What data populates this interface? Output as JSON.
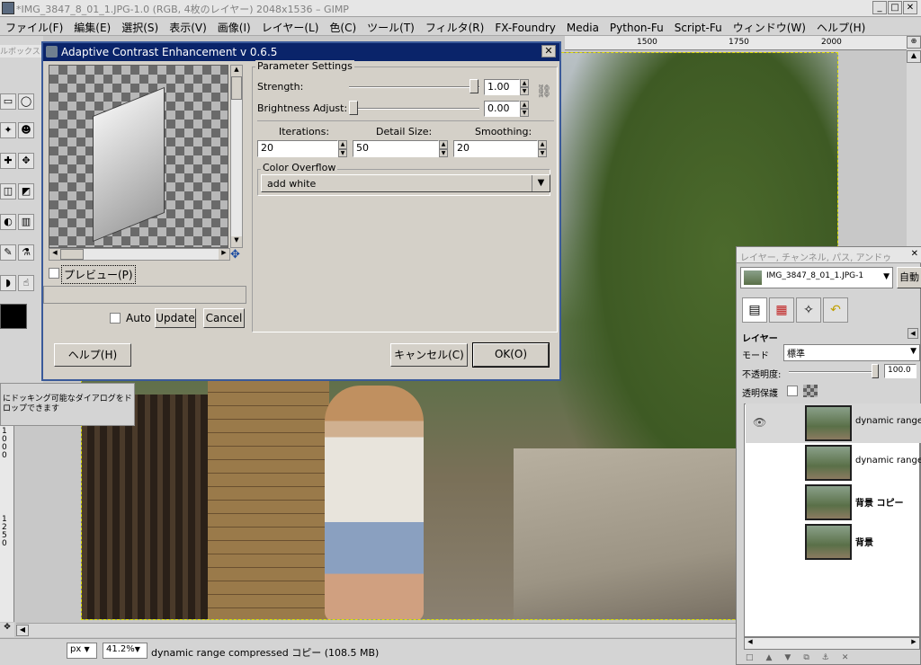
{
  "window": {
    "title": "*IMG_3847_8_01_1.JPG-1.0 (RGB, 4枚のレイヤー) 2048x1536 – GIMP",
    "min": "_",
    "max": "□",
    "close": "✕"
  },
  "menu": [
    "ファイル(F)",
    "編集(E)",
    "選択(S)",
    "表示(V)",
    "画像(I)",
    "レイヤー(L)",
    "色(C)",
    "ツール(T)",
    "フィルタ(R)",
    "FX-Foundry",
    "Media",
    "Python-Fu",
    "Script-Fu",
    "ウィンドウ(W)",
    "ヘルプ(H)"
  ],
  "ruler": {
    "h": [
      "1500",
      "1750",
      "2000"
    ],
    "v": [
      "1000",
      "1250"
    ]
  },
  "toolbox": {
    "label": "ルボックス",
    "dock_hint": "にドッキング可能なダイアログをドロップできます"
  },
  "dialog": {
    "title": "Adaptive Contrast Enhancement v 0.6.5",
    "close": "✕",
    "preview_label": "プレビュー(P)",
    "auto_label": "Auto",
    "update": "Update",
    "cancel": "Cancel",
    "params_title": "Parameter Settings",
    "strength_label": "Strength:",
    "strength_value": "1.00",
    "brightness_label": "Brightness Adjust:",
    "brightness_value": "0.00",
    "iterations_label": "Iterations:",
    "iterations_value": "20",
    "detail_label": "Detail Size:",
    "detail_value": "50",
    "smoothing_label": "Smoothing:",
    "smoothing_value": "20",
    "overflow_title": "Color Overflow",
    "overflow_value": "add white",
    "help": "ヘルプ(H)",
    "cancel_jp": "キャンセル(C)",
    "ok": "OK(O)"
  },
  "status": {
    "unit": "px",
    "zoom": "41.2%",
    "text": "dynamic range compressed コピー (108.5 MB)"
  },
  "dock": {
    "title": "レイヤー, チャンネル, パス, アンドゥ",
    "image_select": "IMG_3847_8_01_1.JPG-1",
    "auto": "自動",
    "panel_title": "レイヤー",
    "mode_label": "モード",
    "mode_value": "標準",
    "opacity_label": "不透明度:",
    "opacity_value": "100.0",
    "lock_label": "透明保護",
    "layers": [
      {
        "name": "dynamic range co",
        "visible": true
      },
      {
        "name": "dynamic range co",
        "visible": false
      },
      {
        "name": "背景 コピー",
        "visible": false
      },
      {
        "name": "背景",
        "visible": false
      }
    ]
  }
}
